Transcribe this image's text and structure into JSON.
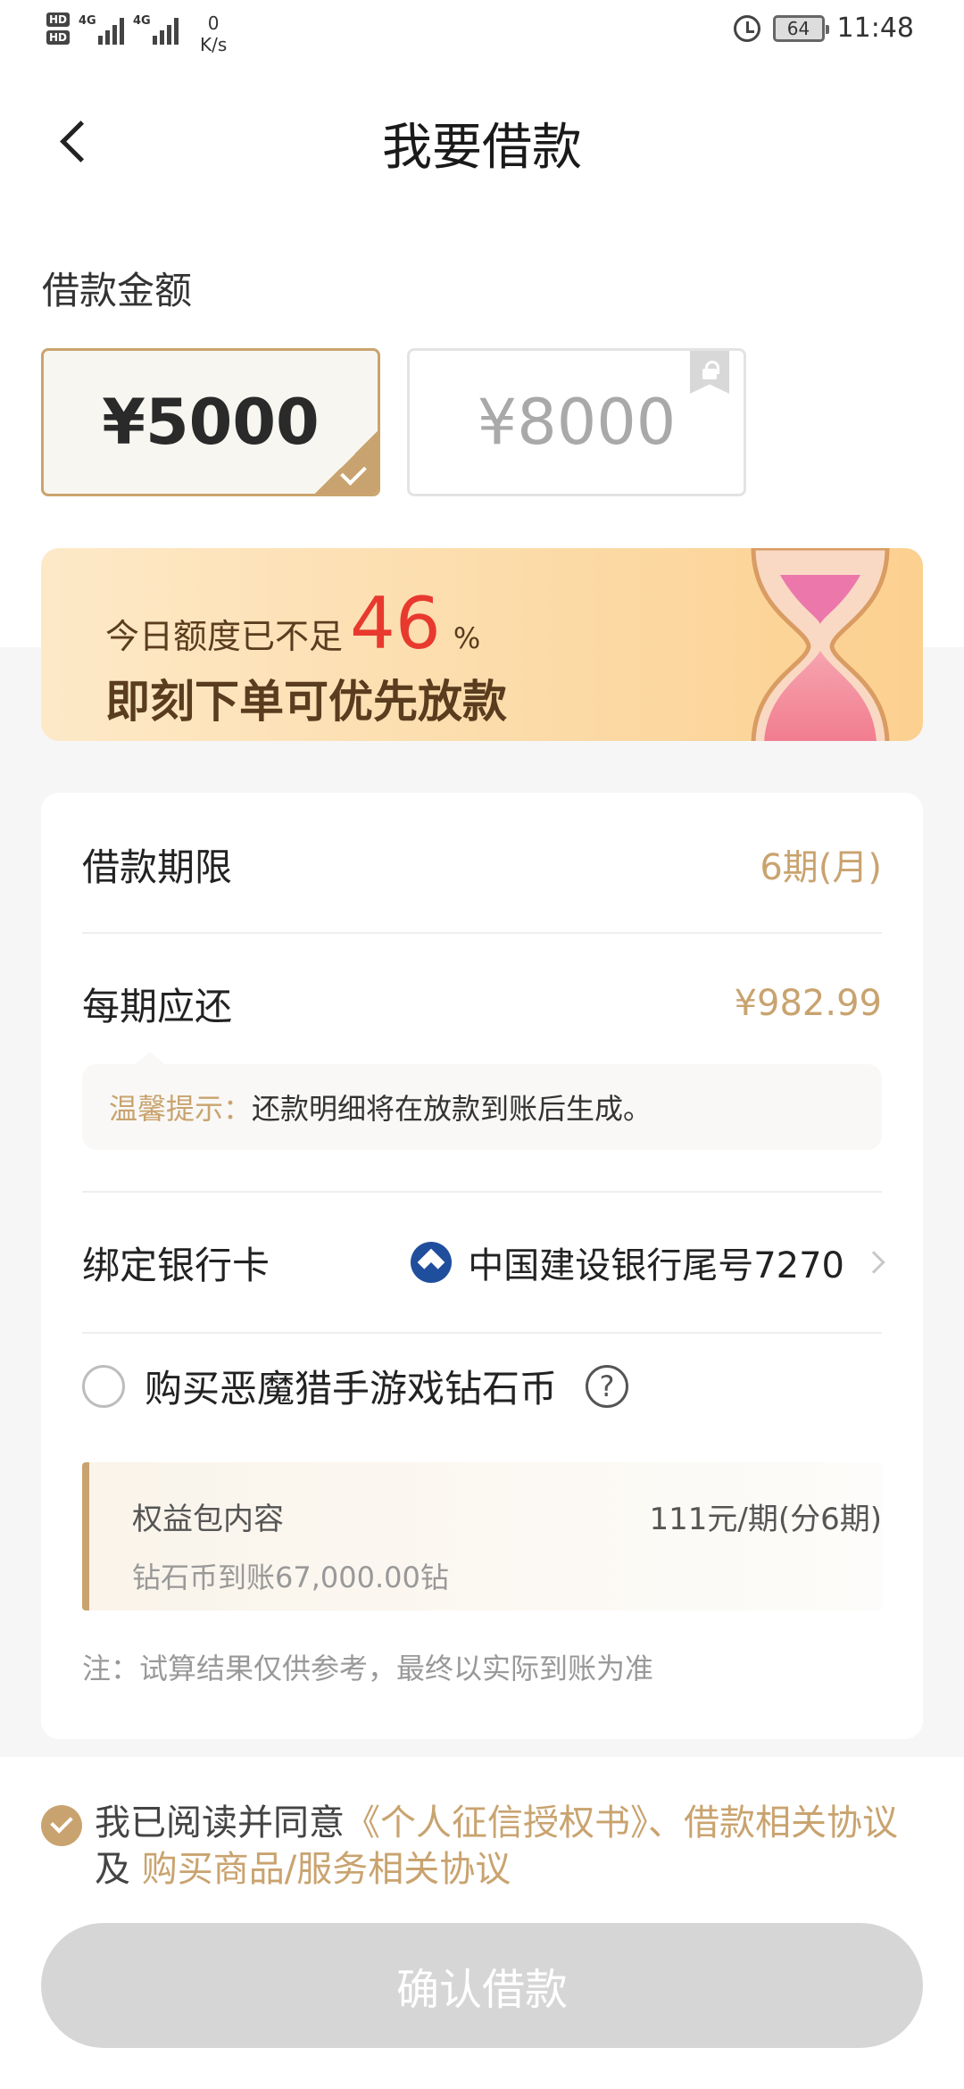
{
  "status_bar": {
    "hd1": "HD",
    "hd2": "HD",
    "net1": "4G",
    "net2": "4G",
    "speed_value": "0",
    "speed_unit": "K/s",
    "battery": "64",
    "time": "11:48"
  },
  "header": {
    "title": "我要借款"
  },
  "amount": {
    "label": "借款金额",
    "options": [
      {
        "text": "¥5000",
        "selected": true
      },
      {
        "text": "¥8000",
        "locked": true
      }
    ]
  },
  "banner": {
    "prefix": "今日额度已不足",
    "percent": "46",
    "unit": "%",
    "headline": "即刻下单可优先放款"
  },
  "details": {
    "term_label": "借款期限",
    "term_value": "6期(月)",
    "installment_label": "每期应还",
    "installment_value": "¥982.99",
    "tip_label": "温馨提示：",
    "tip_text": "还款明细将在放款到账后生成。",
    "bank_label": "绑定银行卡",
    "bank_value": "中国建设银行尾号7270",
    "purchase_label": "购买恶魔猎手游戏钻石币",
    "help_symbol": "?",
    "benefit_title": "权益包内容",
    "benefit_price": "111元/期(分6期)",
    "benefit_sub": "钻石币到账67,000.00钻",
    "note": "注：试算结果仅供参考，最终以实际到账为准"
  },
  "agreement": {
    "prefix": "我已阅读并同意",
    "link1": "《个人征信授权书》、借款相关协议",
    "middle": "及",
    "link2": "购买商品/服务相关协议"
  },
  "confirm_label": "确认借款",
  "colors": {
    "accent": "#c9a36f",
    "warning": "#e8392f",
    "disabled_button": "#d6d6d6"
  }
}
